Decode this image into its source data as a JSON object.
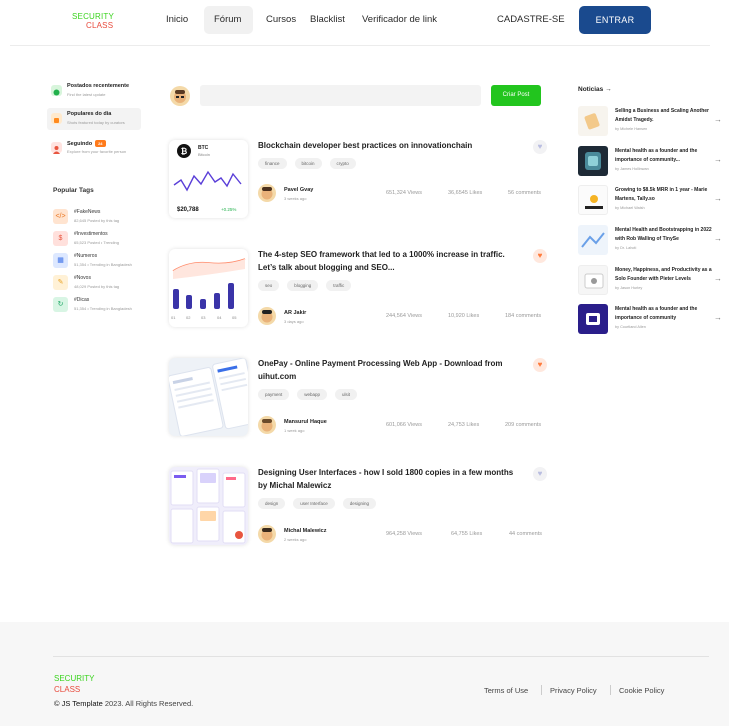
{
  "brand": {
    "line1": "SECURITY",
    "line2": "CLASS"
  },
  "nav": {
    "links": [
      "Inicio",
      "Fórum",
      "Cursos",
      "Blacklist",
      "Verificador de link"
    ],
    "signup": "CADASTRE-SE",
    "enter": "ENTRAR"
  },
  "sidebar": {
    "menu": [
      {
        "title": "Postados recentemente",
        "sub": "Find the latest update"
      },
      {
        "title": "Populares do dia",
        "sub": "Shots featured today by curators"
      },
      {
        "title": "Seguindo",
        "badge": "24",
        "sub": "Explore from your favorite person"
      }
    ],
    "popular_title": "Popular Tags",
    "tags": [
      {
        "name": "#FakeNews",
        "sub": "82,645 Posted by this tag",
        "icon": "code-icon"
      },
      {
        "name": "#Investimentos",
        "sub": "65,523 Posted • Trending",
        "icon": "dollar-icon"
      },
      {
        "name": "#Numeros",
        "sub": "51,354 • Trending in Bangladesh",
        "icon": "chart-icon"
      },
      {
        "name": "#Novos",
        "sub": "48,029 Posted by this tag",
        "icon": "pen-icon"
      },
      {
        "name": "#Dicas",
        "sub": "51,354 • Trending in Bangladesh",
        "icon": "refresh-icon"
      }
    ]
  },
  "composer": {
    "button": "Criar Post"
  },
  "posts": [
    {
      "title": "Blockchain developer best practices on innovationchain",
      "tags": [
        "finance",
        "bitcoin",
        "crypto"
      ],
      "author": "Pavel Gvay",
      "time": "3 weeks ago",
      "views": "651,324 Views",
      "likes": "36,6545 Likes",
      "comments": "56 comments",
      "fav": false,
      "thumb": {
        "coin": "BTC",
        "coin_name": "Bitcoin",
        "price": "$20,788",
        "change": "+0.25%"
      }
    },
    {
      "title": "The 4-step SEO framework that led to a 1000% increase in traffic. Let’s talk about blogging and SEO...",
      "tags": [
        "seo",
        "blogging",
        "traffic"
      ],
      "author": "AR Jakir",
      "time": "3 days ago",
      "views": "244,564 Views",
      "likes": "10,920 Likes",
      "comments": "184 comments",
      "fav": true,
      "thumb": {
        "labels": [
          "01",
          "02",
          "03",
          "04",
          "05"
        ]
      }
    },
    {
      "title": "OnePay - Online Payment Processing Web App - Download from uihut.com",
      "tags": [
        "payment",
        "webapp",
        "ulsit"
      ],
      "author": "Mansurul Haque",
      "time": "1 week ago",
      "views": "601,066 Views",
      "likes": "24,753 Likes",
      "comments": "209 comments",
      "fav": true
    },
    {
      "title": "Designing User Interfaces - how I sold 1800 copies in a few months by Michal Malewicz",
      "tags": [
        "design",
        "user Interface",
        "designing"
      ],
      "author": "Michal Malewicz",
      "time": "2 weeks ago",
      "views": "964,258 Views",
      "likes": "64,755 Likes",
      "comments": "44 comments",
      "fav": false
    }
  ],
  "news": {
    "title": "Noticias",
    "items": [
      {
        "title": "Selling a Business and Scaling Another Amidst Tragedy.",
        "by": "by Michele Hansen"
      },
      {
        "title": "Mental health as a founder and the importance of community...",
        "by": "by James Hollinwan"
      },
      {
        "title": "Growing to $8.5k MRR in 1 year - Marie Martens, Tally.so",
        "by": "by Michael Walsh"
      },
      {
        "title": "Mental Health and Bootstrapping in 2022 with Rob Walling of TinySe",
        "by": "by Dr. Lahoti"
      },
      {
        "title": "Money, Happiness, and Productivity as a Solo Founder with Pieter Levels",
        "by": "by Jason Hurley"
      },
      {
        "title": "Mental health as a founder and the importance of community",
        "by": "by Courtland Allen"
      }
    ]
  },
  "footer": {
    "brand1": "SECURITY",
    "brand2": "CLASS",
    "copy_owner": "© JS Template",
    "copy_rest": " 2023. All Rights Reserved.",
    "links": [
      "Terms of Use",
      "Privacy Policy",
      "Cookie Policy"
    ]
  }
}
